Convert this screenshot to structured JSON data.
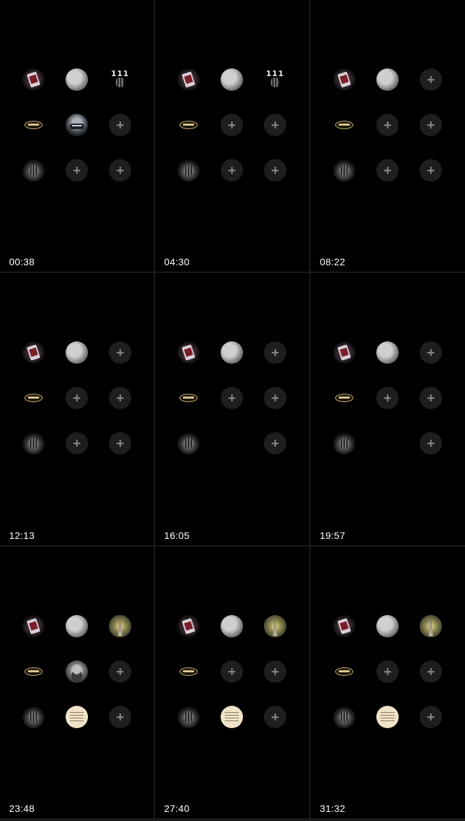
{
  "panels": [
    {
      "timestamp": "00:38",
      "cells": [
        "cards",
        "moon",
        "111",
        "logo",
        "car",
        "add",
        "tiger",
        "add",
        "add"
      ]
    },
    {
      "timestamp": "04:30",
      "cells": [
        "cards",
        "moon",
        "111",
        "logo",
        "add",
        "add",
        "tiger",
        "add",
        "add"
      ]
    },
    {
      "timestamp": "08:22",
      "cells": [
        "cards",
        "moon",
        "add",
        "logo",
        "add",
        "add",
        "tiger",
        "add",
        "add"
      ]
    },
    {
      "timestamp": "12:13",
      "cells": [
        "cards",
        "moon",
        "add",
        "logo",
        "add",
        "add",
        "tiger",
        "add",
        "add"
      ]
    },
    {
      "timestamp": "16:05",
      "cells": [
        "cards",
        "moon",
        "add",
        "logo",
        "add",
        "add",
        "tiger",
        "empty",
        "add"
      ]
    },
    {
      "timestamp": "19:57",
      "cells": [
        "cards",
        "moon",
        "add",
        "logo",
        "add",
        "add",
        "tiger",
        "empty",
        "add"
      ]
    },
    {
      "timestamp": "23:48",
      "cells": [
        "cards",
        "moon",
        "road",
        "logo",
        "portrait",
        "add",
        "tiger",
        "note",
        "add"
      ]
    },
    {
      "timestamp": "27:40",
      "cells": [
        "cards",
        "moon",
        "road",
        "logo",
        "add",
        "add",
        "tiger",
        "note",
        "add"
      ]
    },
    {
      "timestamp": "31:32",
      "cells": [
        "cards",
        "moon",
        "road",
        "logo",
        "add",
        "add",
        "tiger",
        "note",
        "add"
      ]
    }
  ],
  "icon_names": {
    "cards": "playing-card-avatar-icon",
    "moon": "moon-avatar-icon",
    "111": "number-111-tiger-avatar-icon",
    "tiger": "tiger-avatar-icon",
    "logo": "oval-logo-avatar-icon",
    "car": "car-avatar-icon",
    "road": "road-landscape-avatar-icon",
    "portrait": "portrait-avatar-icon",
    "note": "handwritten-note-avatar-icon",
    "add": "add-icon"
  },
  "text_111": "111",
  "colors": {
    "background": "#000000",
    "divider": "#1a1a1a",
    "add_button": "#1e1e1e",
    "plus": "#8a8a8a",
    "timestamp": "#ffffff"
  }
}
